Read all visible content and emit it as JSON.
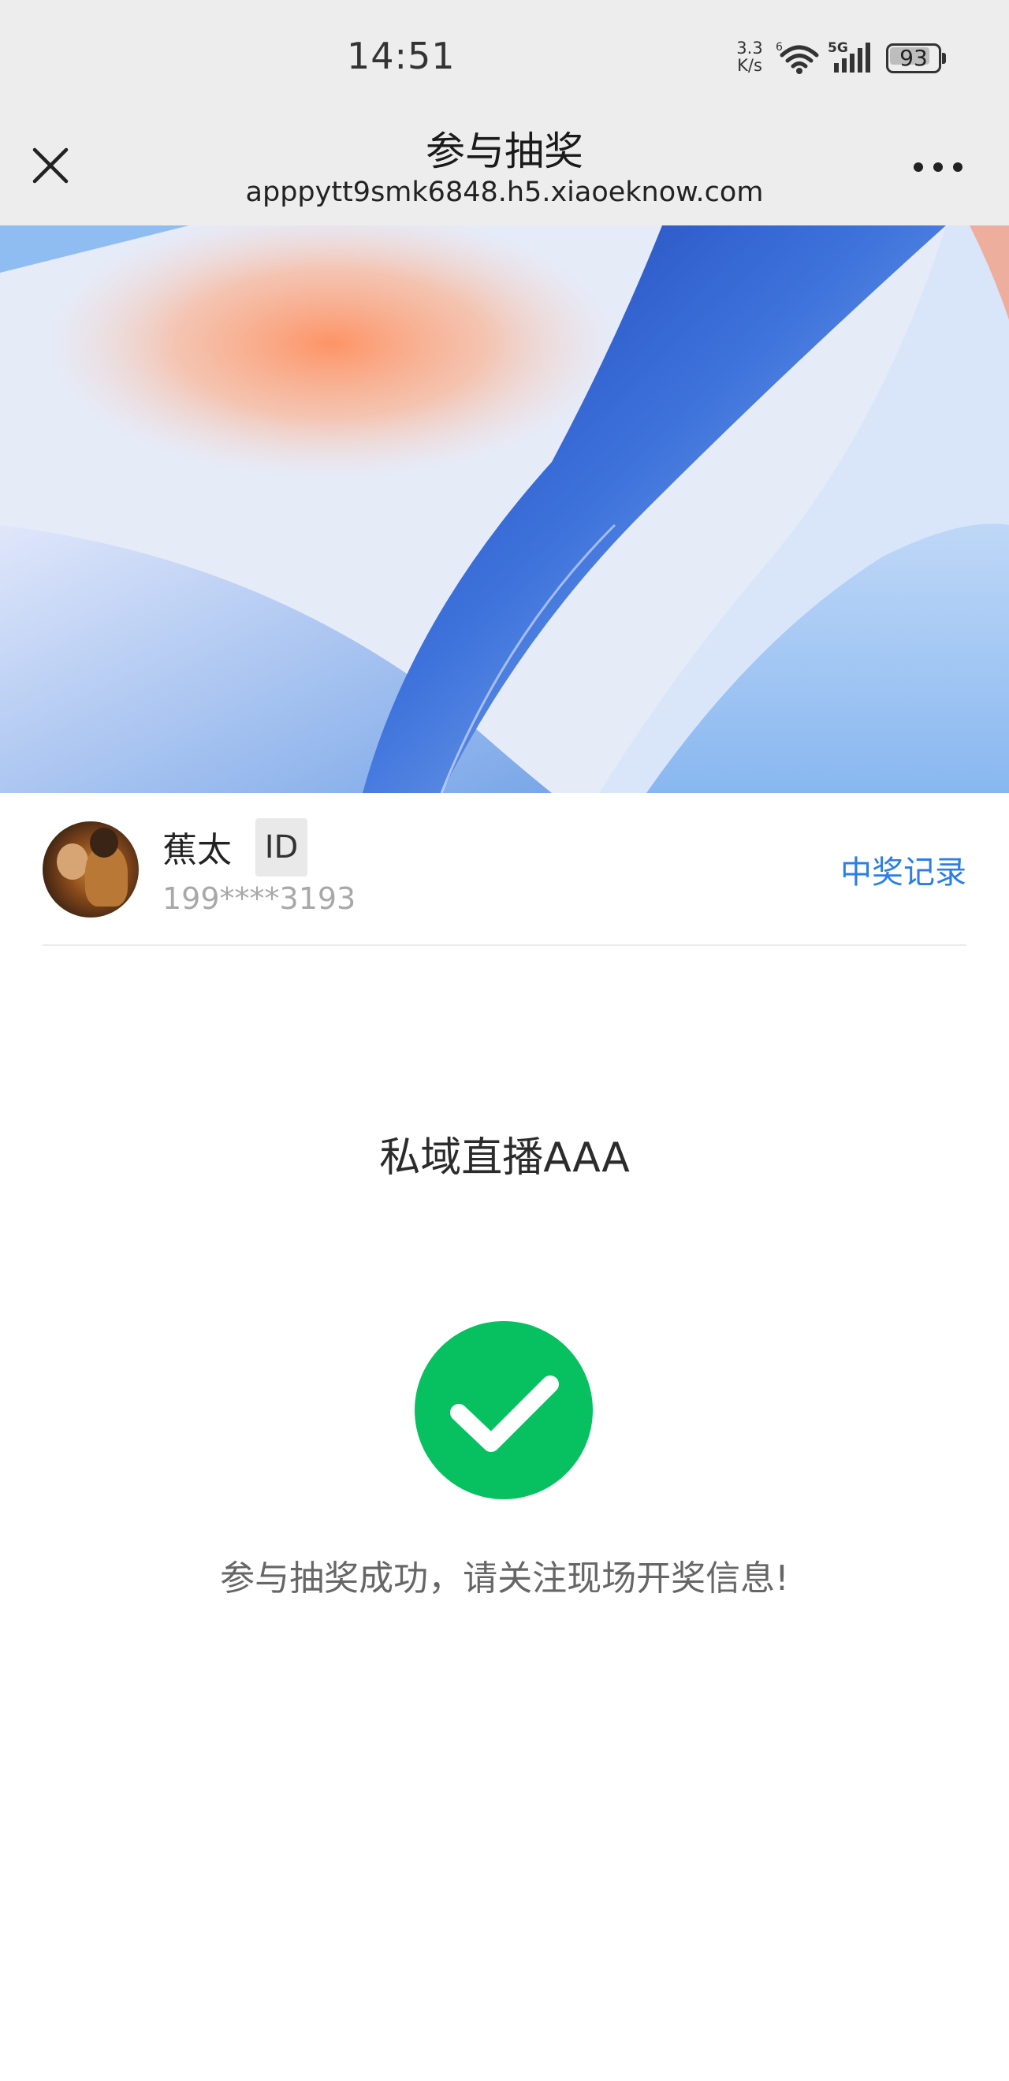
{
  "status_bar": {
    "time": "14:51",
    "net_speed_value": "3.3",
    "net_speed_unit": "K/s",
    "wifi_badge": "6",
    "signal_badge": "5G",
    "battery_level": "93",
    "battery_fraction": 0.93
  },
  "title_bar": {
    "title": "参与抽奖",
    "url": "apppytt9smk6848.h5.xiaoeknow.com",
    "close_icon": "close-icon",
    "more_icon": "more-horizontal-icon"
  },
  "user": {
    "name": "蕉太",
    "id_badge": "ID",
    "phone": "199****3193",
    "records_link": "中奖记录"
  },
  "main": {
    "event_name": "私域直播AAA",
    "success_message": "参与抽奖成功，请关注现场开奖信息!",
    "success_icon": "checkmark-circle-icon"
  },
  "colors": {
    "link": "#2a7ee6",
    "success": "#07c160",
    "bar_background": "#ededed"
  }
}
